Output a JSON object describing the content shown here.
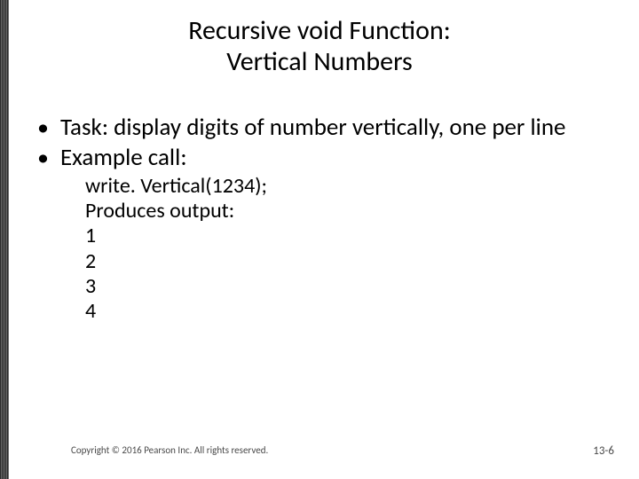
{
  "title": {
    "line1": "Recursive void Function:",
    "line2": "Vertical Numbers"
  },
  "bullets": [
    "Task: display digits of number vertically, one per line",
    "Example call:"
  ],
  "sub": {
    "code": "write. Vertical(1234);",
    "produces": "Produces output:",
    "out1": "1",
    "out2": "2",
    "out3": "3",
    "out4": "4"
  },
  "footer": {
    "copyright": "Copyright © 2016 Pearson Inc. All rights reserved.",
    "pagenum": "13-6"
  }
}
